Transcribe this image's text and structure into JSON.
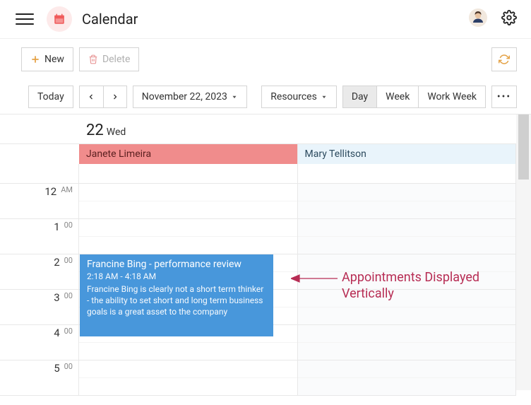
{
  "header": {
    "app_title": "Calendar"
  },
  "toolbar": {
    "new_label": "New",
    "delete_label": "Delete"
  },
  "controls": {
    "today_label": "Today",
    "date_label": "November 22, 2023",
    "resources_label": "Resources",
    "views": {
      "day": "Day",
      "week": "Week",
      "work_week": "Work Week"
    },
    "active_view": "Day",
    "more": "•••"
  },
  "calendar": {
    "day_number": "22",
    "day_name": "Wed",
    "resources": [
      "Janete Limeira",
      "Mary Tellitson"
    ],
    "hours": [
      {
        "hr": "12",
        "suffix": "AM"
      },
      {
        "hr": "1",
        "suffix": "00"
      },
      {
        "hr": "2",
        "suffix": "00"
      },
      {
        "hr": "3",
        "suffix": "00"
      },
      {
        "hr": "4",
        "suffix": "00"
      },
      {
        "hr": "5",
        "suffix": "00"
      }
    ],
    "event": {
      "title": "Francine Bing - performance review",
      "time": "2:18 AM - 4:18 AM",
      "desc": "Francine Bing is clearly not a short term thinker - the ability to set short and long term business goals is a great asset to the company"
    }
  },
  "annotation": {
    "text_line1": "Appointments Displayed",
    "text_line2": "Vertically"
  }
}
